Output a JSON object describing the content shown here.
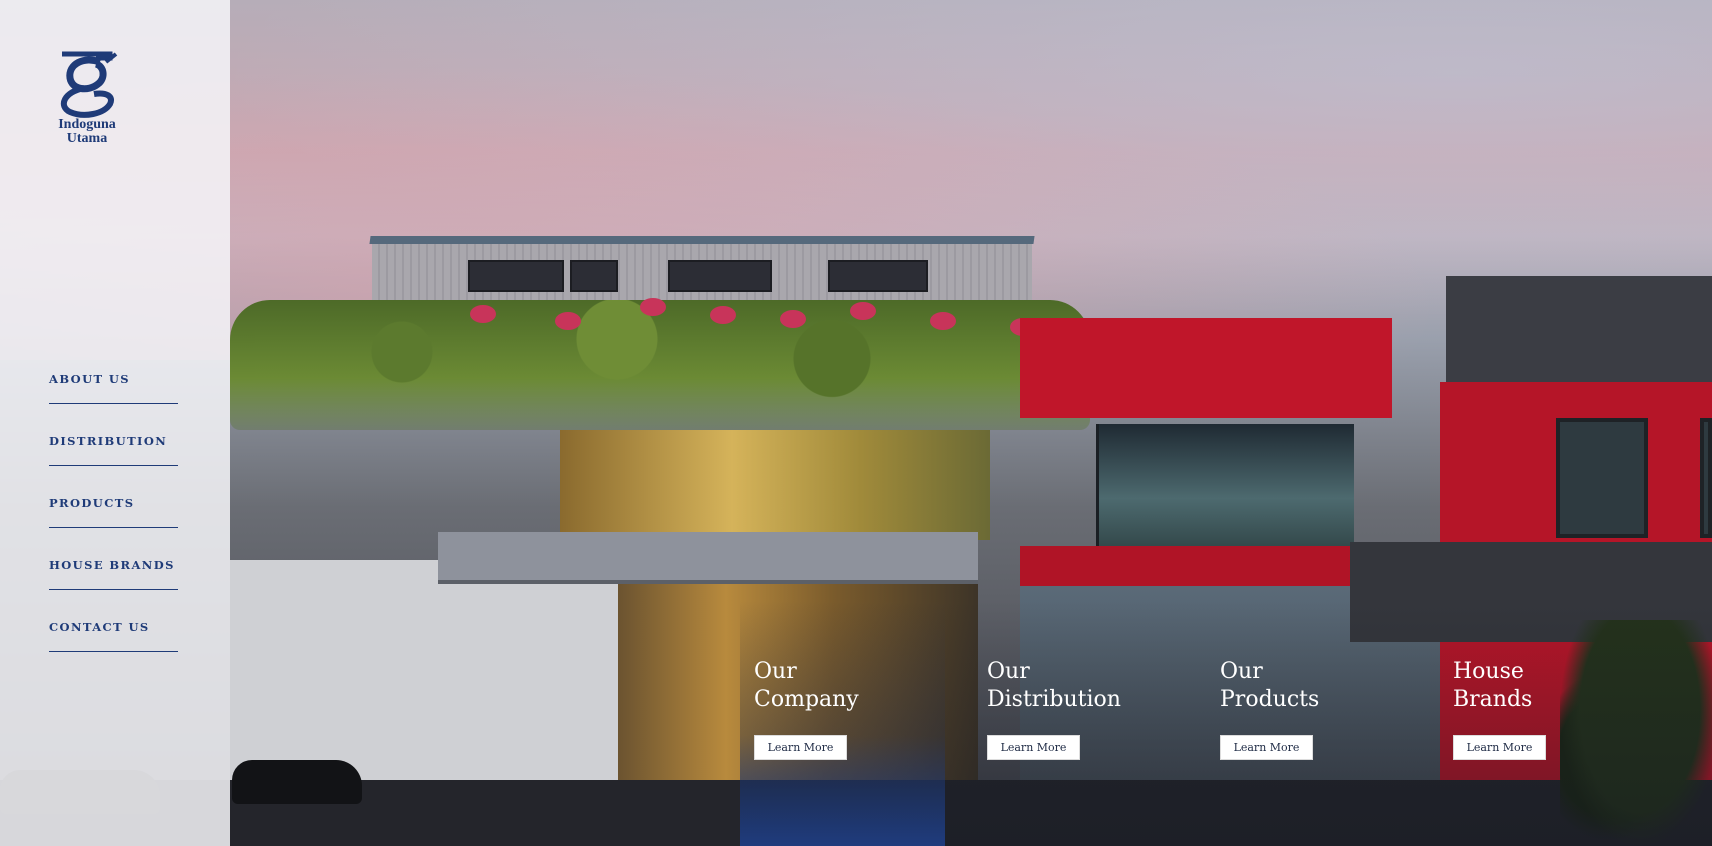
{
  "brand": {
    "name_line1": "Indoguna",
    "name_line2": "Utama",
    "color": "#1f3b78"
  },
  "nav": {
    "items": [
      {
        "label": "ABOUT US"
      },
      {
        "label": "DISTRIBUTION"
      },
      {
        "label": "PRODUCTS"
      },
      {
        "label": "HOUSE BRANDS"
      },
      {
        "label": "CONTACT US"
      }
    ]
  },
  "tiles": [
    {
      "title": "Our\nCompany",
      "button": "Learn More",
      "active": true
    },
    {
      "title": "Our\nDistribution",
      "button": "Learn More",
      "active": false
    },
    {
      "title": "Our\nProducts",
      "button": "Learn More",
      "active": false
    },
    {
      "title": "House\nBrands",
      "button": "Learn More",
      "active": false
    }
  ],
  "colors": {
    "accent_navy": "#1f3b78",
    "active_tile": "#1f3d82",
    "sidebar_bg": "#f4f5f8"
  }
}
